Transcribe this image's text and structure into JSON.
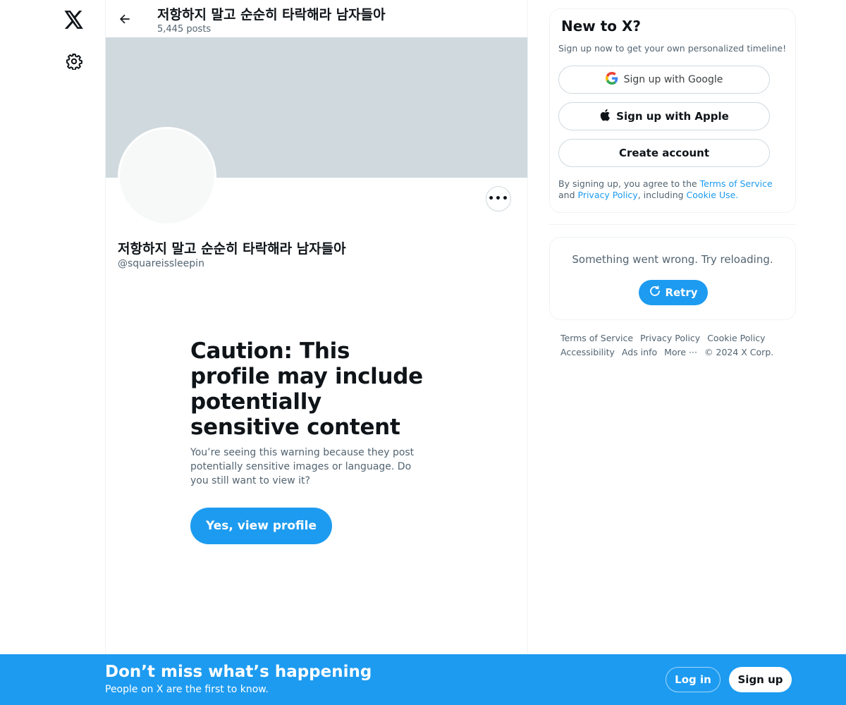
{
  "header": {
    "title": "저항하지 말고 순순히 타락해라 남자들아",
    "posts_count": "5,445 posts"
  },
  "profile": {
    "display_name": "저항하지 말고 순순히 타락해라 남자들아",
    "handle": "@squareissleepin",
    "more_label": "•••"
  },
  "warning": {
    "title": "Caution: This profile may include potentially sensitive content",
    "body": "You’re seeing this warning because they post potentially sensitive images or language. Do you still want to view it?",
    "button": "Yes, view profile"
  },
  "sidebar_card": {
    "title": "New to X?",
    "subtitle": "Sign up now to get your own personalized timeline!",
    "google_label": "Sign up with Google",
    "apple_label": "Sign up with Apple",
    "create_label": "Create account",
    "terms_prefix": "By signing up, you agree to the ",
    "terms_link": "Terms of Service",
    "terms_and": " and ",
    "privacy_link": "Privacy Policy",
    "terms_mid": ", including ",
    "cookie_link": "Cookie Use."
  },
  "error_card": {
    "message": "Something went wrong. Try reloading.",
    "retry_label": "Retry"
  },
  "footer": {
    "terms": "Terms of Service",
    "privacy": "Privacy Policy",
    "cookie": "Cookie Policy",
    "accessibility": "Accessibility",
    "ads": "Ads info",
    "more": "More ···",
    "copyright": "© 2024 X Corp."
  },
  "bottom_bar": {
    "title": "Don’t miss what’s happening",
    "subtitle": "People on X are the first to know.",
    "login": "Log in",
    "signup": "Sign up"
  },
  "colors": {
    "accent": "#1d9bf0",
    "banner": "#cfd9de",
    "muted_text": "#536471"
  },
  "icons": [
    "x-logo-icon",
    "gear-icon",
    "back-arrow-icon",
    "more-dots-icon",
    "google-icon",
    "apple-icon",
    "refresh-icon"
  ]
}
